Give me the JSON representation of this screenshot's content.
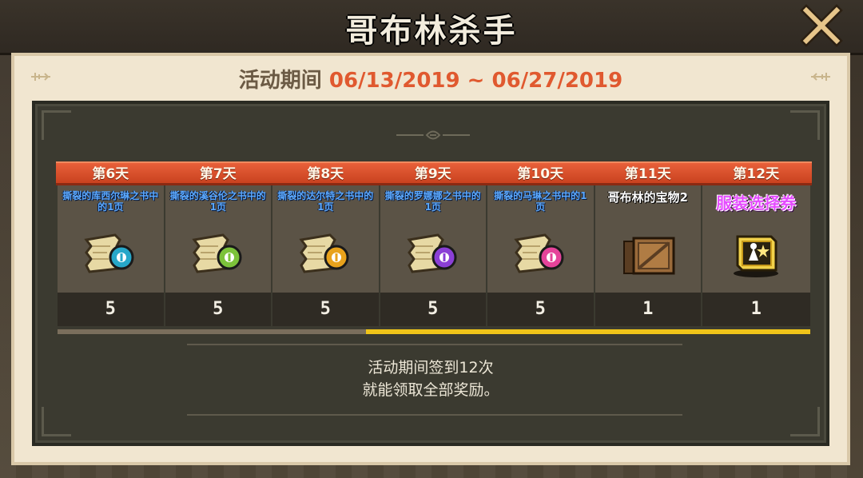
{
  "title": "哥布林杀手",
  "close_icon": "close-x-icon",
  "period": {
    "label": "活动期间",
    "dates": "06/13/2019 ~ 06/27/2019",
    "date_color": "#e0592f"
  },
  "days": [
    {
      "day": "第6天",
      "name": "撕裂的库西尔琳之书中的1页",
      "count": "5",
      "icon": "torn-page-scroll-icon",
      "gem_color": "#27a7c9",
      "style": "blue"
    },
    {
      "day": "第7天",
      "name": "撕裂的溪谷伦之书中的1页",
      "count": "5",
      "icon": "torn-page-scroll-icon",
      "gem_color": "#7cc23a",
      "style": "blue"
    },
    {
      "day": "第8天",
      "name": "撕裂的达尔特之书中的1页",
      "count": "5",
      "icon": "torn-page-scroll-icon",
      "gem_color": "#e8a21c",
      "style": "blue"
    },
    {
      "day": "第9天",
      "name": "撕裂的罗娜娜之书中的1页",
      "count": "5",
      "icon": "torn-page-scroll-icon",
      "gem_color": "#8b3fd6",
      "style": "blue"
    },
    {
      "day": "第10天",
      "name": "撕裂的马琳之书中的1页",
      "count": "5",
      "icon": "torn-page-scroll-icon",
      "gem_color": "#e5439a",
      "style": "blue"
    },
    {
      "day": "第11天",
      "name": "哥布林的宝物2",
      "count": "1",
      "icon": "wooden-crate-icon",
      "style": "white"
    },
    {
      "day": "第12天",
      "name": "服装选择券",
      "count": "1",
      "icon": "costume-ticket-icon",
      "style": "magenta"
    }
  ],
  "progress": {
    "completed_fraction": 0.59,
    "fill_color": "#f0c419"
  },
  "info": {
    "line1": "活动期间签到12次",
    "line2": "就能领取全部奖励。"
  }
}
